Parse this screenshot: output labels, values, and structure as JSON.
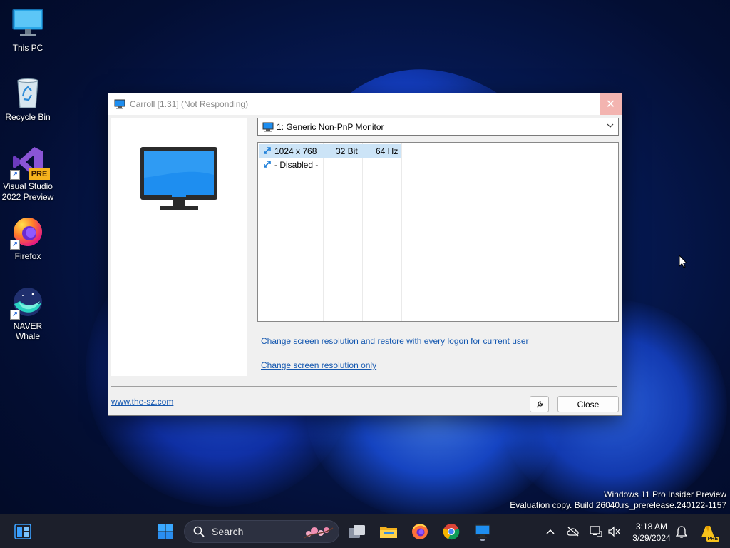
{
  "desktop": {
    "icons": [
      {
        "label": "This PC"
      },
      {
        "label": "Recycle Bin"
      },
      {
        "label": "Visual Studio 2022 Preview",
        "badge": "PRE"
      },
      {
        "label": "Firefox"
      },
      {
        "label": "NAVER Whale"
      }
    ]
  },
  "window": {
    "title": "Carroll [1.31] (Not Responding)",
    "close_glyph": "✕",
    "monitor_selected": "1: Generic Non-PnP Monitor",
    "modes": [
      {
        "resolution": "1024 x 768",
        "bits": "32 Bit",
        "hz": "64 Hz"
      },
      {
        "resolution": "- Disabled -",
        "bits": "",
        "hz": ""
      }
    ],
    "link_restore": "Change screen resolution and restore with every logon for current user",
    "link_only": "Change screen resolution only",
    "website": "www.the-sz.com",
    "close_button": "Close"
  },
  "watermark": {
    "line1": "Windows 11 Pro Insider Preview",
    "line2": "Evaluation copy. Build 26040.rs_prerelease.240122-1157"
  },
  "taskbar": {
    "search_label": "Search",
    "time": "3:18 AM",
    "date": "3/29/2024",
    "tray_badge": "PRE"
  },
  "colors": {
    "accent": "#0078d4",
    "selection": "#cce4f7",
    "link": "#1558b0",
    "monitor_blue": "#1e8ef0"
  }
}
